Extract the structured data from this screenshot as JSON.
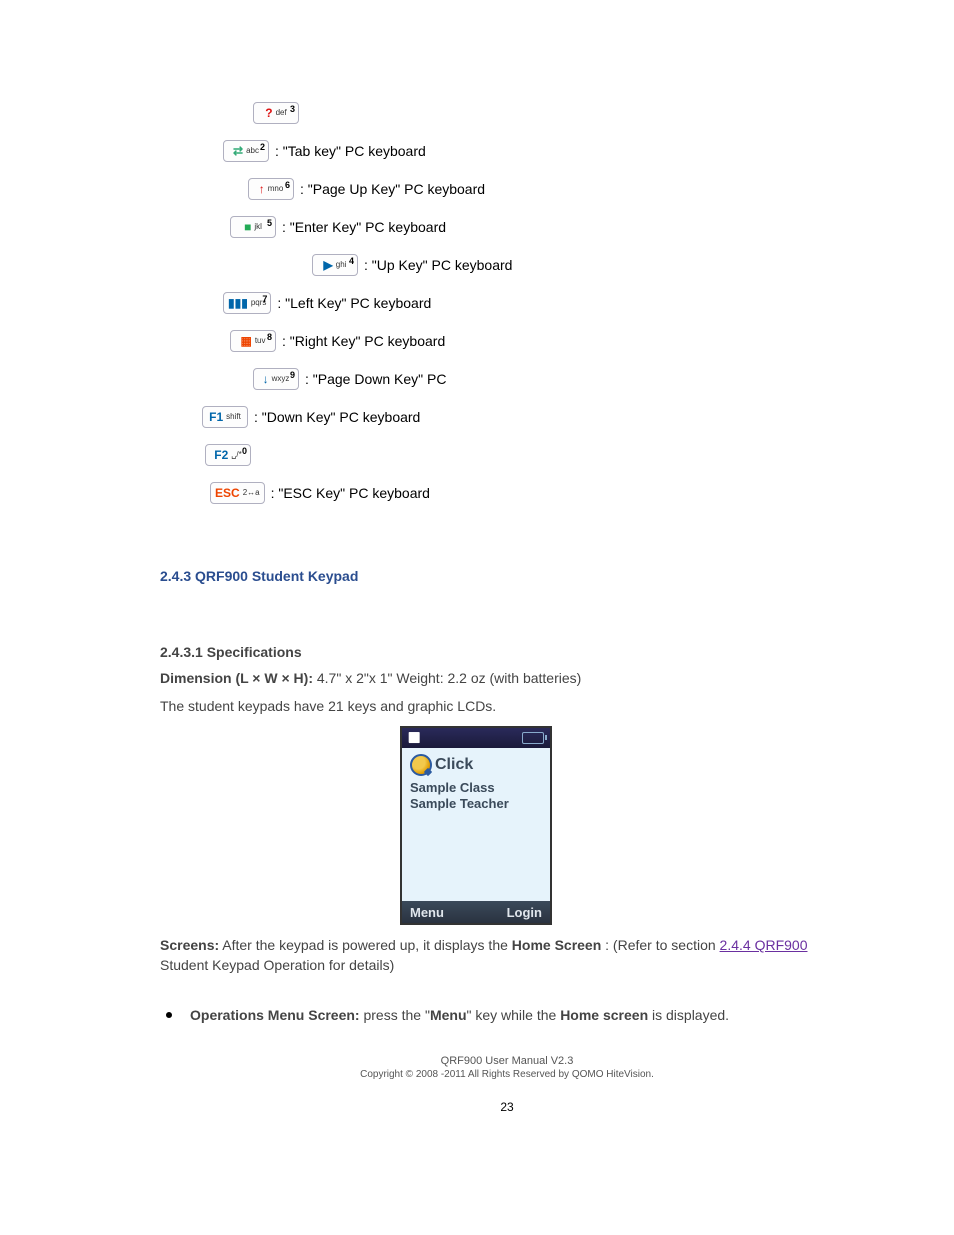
{
  "keys": [
    {
      "indent": "indent-10",
      "iconColor": "#d11",
      "iconText": "?",
      "sub": "def",
      "num": "3",
      "desc": ""
    },
    {
      "indent": "indent-4",
      "iconColor": "#3a7",
      "iconText": "⇄",
      "sub": "abc",
      "num": "2",
      "desc": ": \"Tab key\" PC keyboard"
    },
    {
      "indent": "indent-1",
      "iconColor": "#d11",
      "iconText": "↑",
      "sub": "mno",
      "num": "6",
      "desc": ": \"Page Up Key\" PC keyboard"
    },
    {
      "indent": "indent-2",
      "iconColor": "#2a5",
      "iconText": "■",
      "sub": "jkl",
      "num": "5",
      "desc": ": \"Enter Key\" PC keyboard"
    },
    {
      "indent": "indent-3",
      "iconColor": "#06a",
      "iconText": "▶",
      "sub": "ghi",
      "num": "4",
      "desc": ": \"Up Key\" PC keyboard"
    },
    {
      "indent": "indent-4",
      "iconColor": "#06a",
      "iconText": "▮▮▮",
      "sub": "pqrs",
      "num": "7",
      "desc": ": \"Left Key\" PC keyboard"
    },
    {
      "indent": "indent-5",
      "iconColor": "#e40",
      "iconText": "▦",
      "sub": "tuv",
      "num": "8",
      "desc": ": \"Right Key\" PC keyboard"
    },
    {
      "indent": "indent-6",
      "iconColor": "#06a",
      "iconText": "↓",
      "sub": "wxyz",
      "num": "9",
      "desc": ": \"Page Down Key\" PC"
    },
    {
      "indent": "indent-7",
      "iconColor": "#06a",
      "iconText": "F1",
      "sub": "shift",
      "num": "",
      "desc": ": \"Down Key\" PC keyboard"
    },
    {
      "indent": "indent-8",
      "iconColor": "#06a",
      "iconText": "F2",
      "sub": "␣/*",
      "num": "0",
      "desc": ""
    },
    {
      "indent": "indent-9",
      "iconColor": "#e40",
      "iconText": "ESC",
      "sub": "2↔a",
      "num": "",
      "desc": ": \"ESC Key\" PC keyboard"
    }
  ],
  "section": {
    "heading": "2.4.3 QRF900 Student Keypad",
    "sub1": "2.4.3.1 Specifications",
    "spec_dim_label": "Dimension (L × W × H):",
    "spec_dim_val": "4.7\" x 2\"x 1\" Weight: 2.2 oz (with batteries)",
    "spec_keytext": "The student keypads have 21 keys and graphic LCDs."
  },
  "device": {
    "logo": "Click",
    "line1": "Sample Class",
    "line2": "Sample Teacher",
    "menu": "Menu",
    "login": "Login"
  },
  "screens": {
    "title": "Screens:",
    "text_prefix": "After the keypad is powered up, it displays the ",
    "text_bold": "Home Screen",
    "text_mid": ": (Refer to section ",
    "link": "2.4.4 QRF900",
    "text_end": " Student Keypad Operation for details)"
  },
  "bullet_items": {
    "strong1": "Operations Menu Screen:",
    "t1": " press the \"",
    "strong2": "Menu",
    "t2": "\" key while the ",
    "strong3": "Home screen",
    "t3": " is displayed."
  },
  "footer": {
    "line1": "QRF900 User Manual V2.3",
    "line2": "Copyright © 2008 -2011 All Rights Reserved by QOMO HiteVision.",
    "page": "23"
  }
}
